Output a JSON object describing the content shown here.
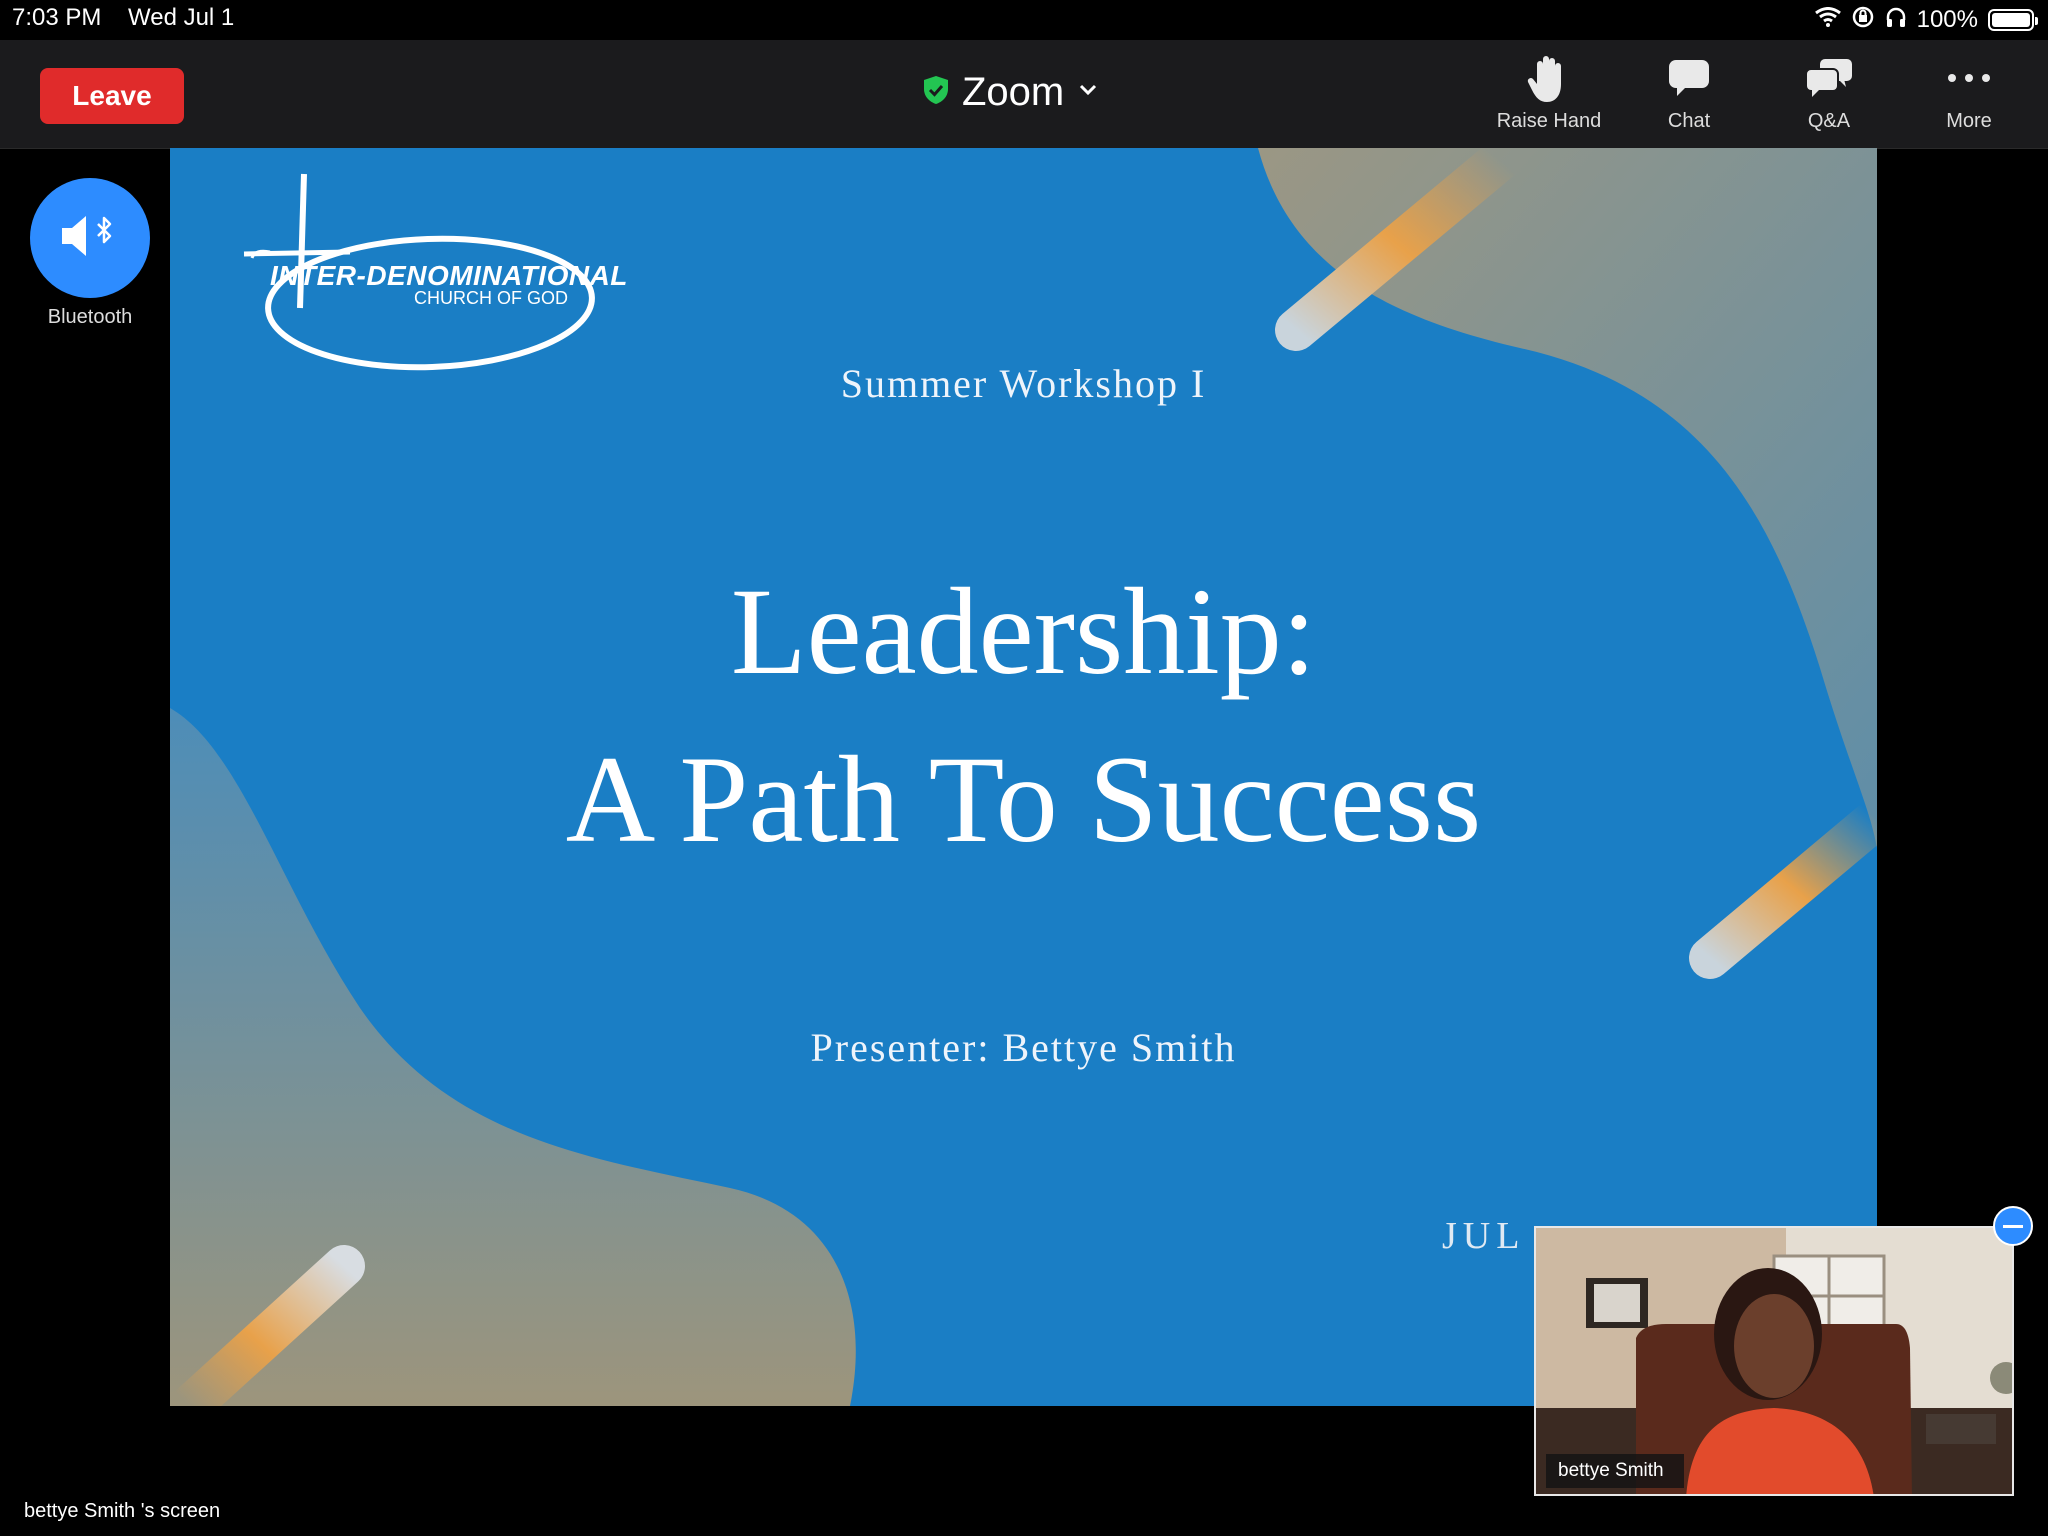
{
  "status_bar": {
    "time": "7:03 PM",
    "date": "Wed Jul 1",
    "battery": "100%",
    "icons": [
      "wifi-icon",
      "orientation-lock-icon",
      "headphones-icon",
      "battery-icon"
    ]
  },
  "toolbar": {
    "leave_label": "Leave",
    "meeting_title": "Zoom",
    "actions": [
      {
        "label": "Raise Hand",
        "icon": "raise-hand-icon"
      },
      {
        "label": "Chat",
        "icon": "chat-icon"
      },
      {
        "label": "Q&A",
        "icon": "qa-icon"
      },
      {
        "label": "More",
        "icon": "more-icon"
      }
    ],
    "colors": {
      "leave": "#e02b2b",
      "shield": "#23c552",
      "accent": "#2d8cff"
    }
  },
  "audio": {
    "label": "Bluetooth",
    "icon": "speaker-bluetooth-icon"
  },
  "slide": {
    "logo_line1": "INTER-DENOMINATIONAL",
    "logo_line2": "CHURCH OF GOD",
    "workshop": "Summer Workshop I",
    "title_line1": "Leadership:",
    "title_line2": "A Path To Success",
    "presenter": "Presenter: Bettye Smith",
    "date_partial": "JUL",
    "colors": {
      "background": "#1a7ec5",
      "shape": "#8a9486",
      "streak": "#e8a14a"
    }
  },
  "video_thumbnail": {
    "name": "bettye Smith"
  },
  "share_label": "bettye Smith 's screen"
}
